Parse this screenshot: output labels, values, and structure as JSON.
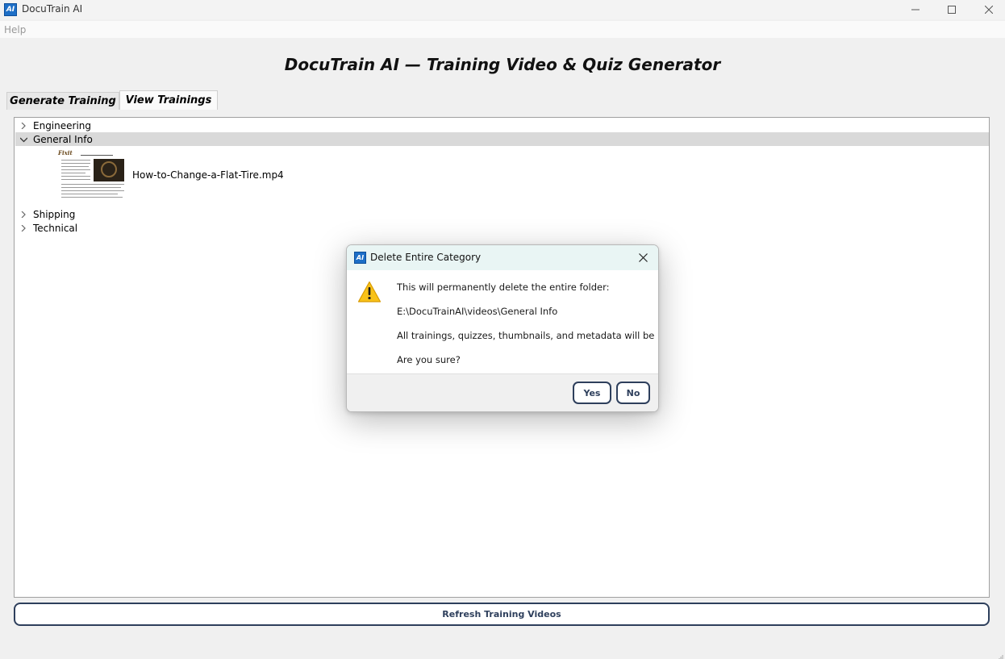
{
  "window": {
    "title": "DocuTrain AI",
    "icon_text": "AI"
  },
  "menu": {
    "items": [
      "Help"
    ]
  },
  "header": {
    "title": "DocuTrain AI — Training Video & Quiz Generator"
  },
  "tabs": [
    {
      "label": "Generate Training",
      "active": false
    },
    {
      "label": "View Trainings",
      "active": true
    }
  ],
  "tree": {
    "categories": [
      {
        "label": "Engineering",
        "expanded": false
      },
      {
        "label": "General Info",
        "expanded": true,
        "selected": true,
        "videos": [
          {
            "name": "How-to-Change-a-Flat-Tire.mp4",
            "thumbnail": "flat-tire-document-thumbnail"
          }
        ]
      },
      {
        "label": "Shipping",
        "expanded": false
      },
      {
        "label": "Technical",
        "expanded": false
      }
    ]
  },
  "refresh_button": {
    "label": "Refresh Training Videos"
  },
  "dialog": {
    "title": "Delete Entire Category",
    "icon": "warning-icon",
    "lines": [
      "This will permanently delete the entire folder:",
      "E:\\DocuTrainAI\\videos\\General Info",
      "All trainings, quizzes, thumbnails, and metadata will be lost.",
      "Are you sure?"
    ],
    "yes_label": "Yes",
    "no_label": "No"
  },
  "colors": {
    "accent": "#2e3f5c",
    "selection": "#d9d9d9",
    "dialog_titlebar": "#e9f5f4",
    "warning": "#f5b400"
  }
}
